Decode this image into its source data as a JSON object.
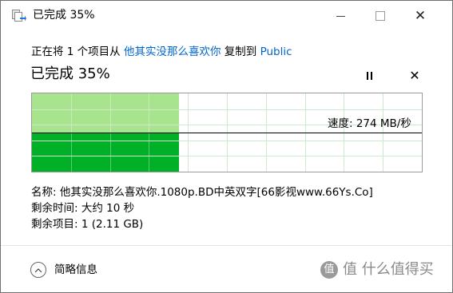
{
  "window": {
    "title": "已完成 35%",
    "minimize_label": "—",
    "close_label": "✕"
  },
  "status": {
    "prefix": "正在将 1 个项目从 ",
    "source": "他其实没那么喜欢你",
    "middle": " 复制到 ",
    "destination": "Public"
  },
  "progress": {
    "heading": "已完成 35%",
    "percent": 35,
    "pause_label": "暂停",
    "cancel_label": "✕"
  },
  "speed": {
    "label": "速度: 274 MB/秒",
    "level": 0.5
  },
  "details": {
    "name": "名称: 他其实没那么喜欢你.1080p.BD中英双字[66影视www.66Ys.Co]",
    "time_remaining": "剩余时间: 大约 10 秒",
    "items_remaining": "剩余项目: 1 (2.11 GB)"
  },
  "footer": {
    "toggle_label": "简略信息",
    "watermark": "值 什么值得买"
  },
  "colors": {
    "progress_fill": "#00b026",
    "progress_fill_light": "#a8e48e",
    "link": "#0066cc"
  }
}
